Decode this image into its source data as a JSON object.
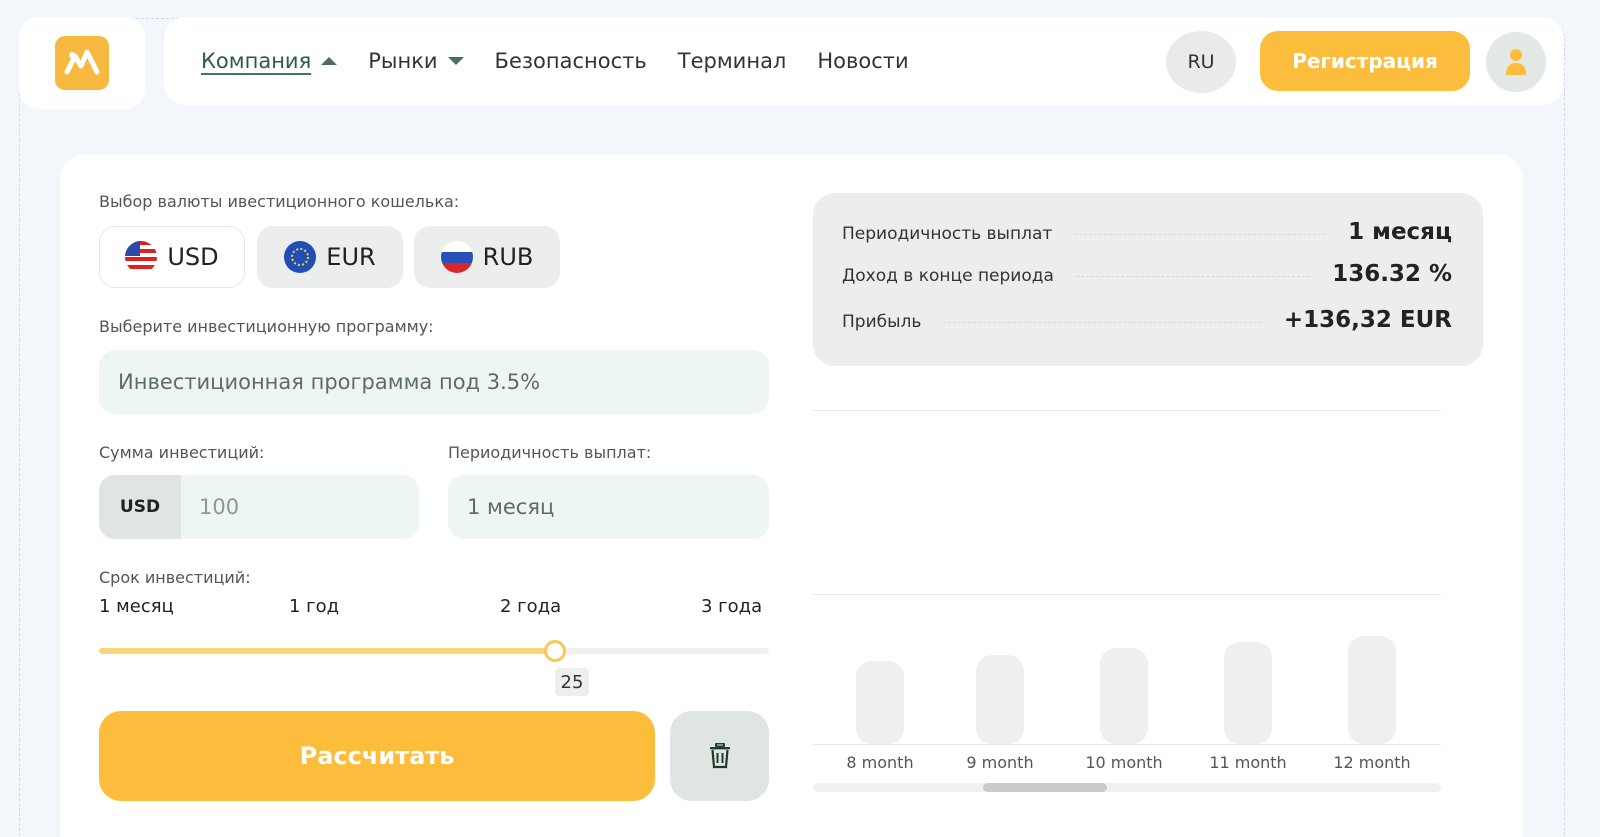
{
  "header": {
    "nav": [
      {
        "label": "Компания",
        "caret": "up"
      },
      {
        "label": "Рынки",
        "caret": "down"
      },
      {
        "label": "Безопасность"
      },
      {
        "label": "Терминал"
      },
      {
        "label": "Новости"
      }
    ],
    "language": "RU",
    "register_label": "Регистрация",
    "colors": {
      "accent": "#fcbd3d",
      "brand_green": "#3d7a58"
    }
  },
  "calculator": {
    "currency_label": "Выбор валюты ивестиционного кошелька:",
    "currencies": [
      {
        "code": "USD",
        "icon": "us-flag-icon",
        "selected": true
      },
      {
        "code": "EUR",
        "icon": "eu-flag-icon",
        "selected": false
      },
      {
        "code": "RUB",
        "icon": "ru-flag-icon",
        "selected": false
      }
    ],
    "program_label": "Выберите инвестиционную программу:",
    "program_value": "Инвестиционная программа под 3.5%",
    "amount_label": "Сумма инвестиций:",
    "amount_currency": "USD",
    "amount_value": "100",
    "period_label": "Периодичность выплат:",
    "period_value": "1 месяц",
    "term_label": "Срок инвестиций:",
    "term_marks": [
      "1 месяц",
      "1 год",
      "2 года",
      "3 года"
    ],
    "term_value": "25",
    "term_fraction": 0.68,
    "calculate_label": "Рассчитать",
    "clear_icon": "trash-icon"
  },
  "summary": {
    "rows": [
      {
        "key": "Периодичность выплат",
        "value": "1 месяц"
      },
      {
        "key": "Доход в конце периода",
        "value": "136.32 %"
      },
      {
        "key": "Прибыль",
        "value": "+136,32  EUR"
      }
    ]
  },
  "chart_data": {
    "type": "bar",
    "categories": [
      "8 month",
      "9 month",
      "10 month",
      "11 month",
      "12 month"
    ],
    "values": [
      82,
      88,
      95,
      101,
      107
    ],
    "ylim": [
      0,
      330
    ],
    "grid": true,
    "colors": {
      "bar": "#eeefee"
    }
  }
}
